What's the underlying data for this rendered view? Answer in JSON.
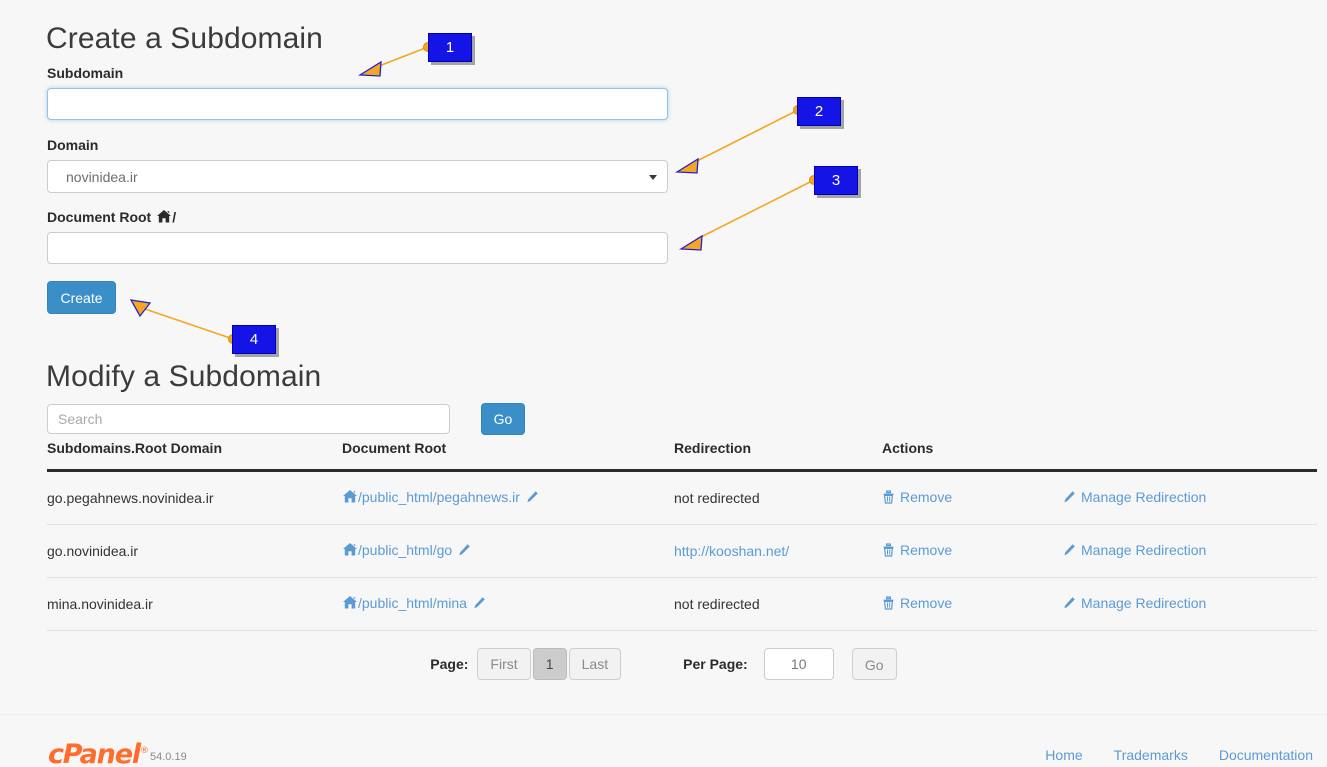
{
  "create_section": {
    "title": "Create a Subdomain",
    "subdomain_label": "Subdomain",
    "subdomain_value": "",
    "subdomain_placeholder": "",
    "domain_label": "Domain",
    "domain_selected": "novinidea.ir",
    "document_root_label": "Document Root",
    "document_root_suffix": "/",
    "document_root_value": "",
    "document_root_placeholder": "",
    "create_button": "Create"
  },
  "modify_section": {
    "title": "Modify a Subdomain",
    "search_value": "",
    "search_placeholder": "Search",
    "search_go_button": "Go",
    "columns": [
      "Subdomains.Root Domain",
      "Document Root",
      "Redirection",
      "Actions",
      ""
    ],
    "rows": [
      {
        "domain": "go.pegahnews.novinidea.ir",
        "document_root": "/public_html/pegahnews.ir",
        "redirection": "not redirected",
        "redirection_is_link": false,
        "remove_label": "Remove",
        "manage_label": "Manage Redirection"
      },
      {
        "domain": "go.novinidea.ir",
        "document_root": "/public_html/go",
        "redirection": "http://kooshan.net/",
        "redirection_is_link": true,
        "remove_label": "Remove",
        "manage_label": "Manage Redirection"
      },
      {
        "domain": "mina.novinidea.ir",
        "document_root": "/public_html/mina",
        "redirection": "not redirected",
        "redirection_is_link": false,
        "remove_label": "Remove",
        "manage_label": "Manage Redirection"
      }
    ]
  },
  "pagination": {
    "page_label": "Page:",
    "first_label": "First",
    "current_page": "1",
    "last_label": "Last",
    "per_page_label": "Per Page:",
    "per_page_value": "10",
    "go_label": "Go"
  },
  "footer": {
    "brand": "cPanel",
    "registered_mark": "®",
    "version": "54.0.19",
    "links": [
      "Home",
      "Trademarks",
      "Documentation"
    ]
  },
  "annotations": [
    {
      "number": "1"
    },
    {
      "number": "2"
    },
    {
      "number": "3"
    },
    {
      "number": "4"
    }
  ],
  "colors": {
    "accent_blue": "#3a8fc9",
    "link_blue": "#5b9bd5",
    "brand_orange": "#ff6c2c",
    "annotation_blue": "#1414e6",
    "annotation_orange": "#f5a623",
    "page_bg": "#f7f7f7"
  }
}
